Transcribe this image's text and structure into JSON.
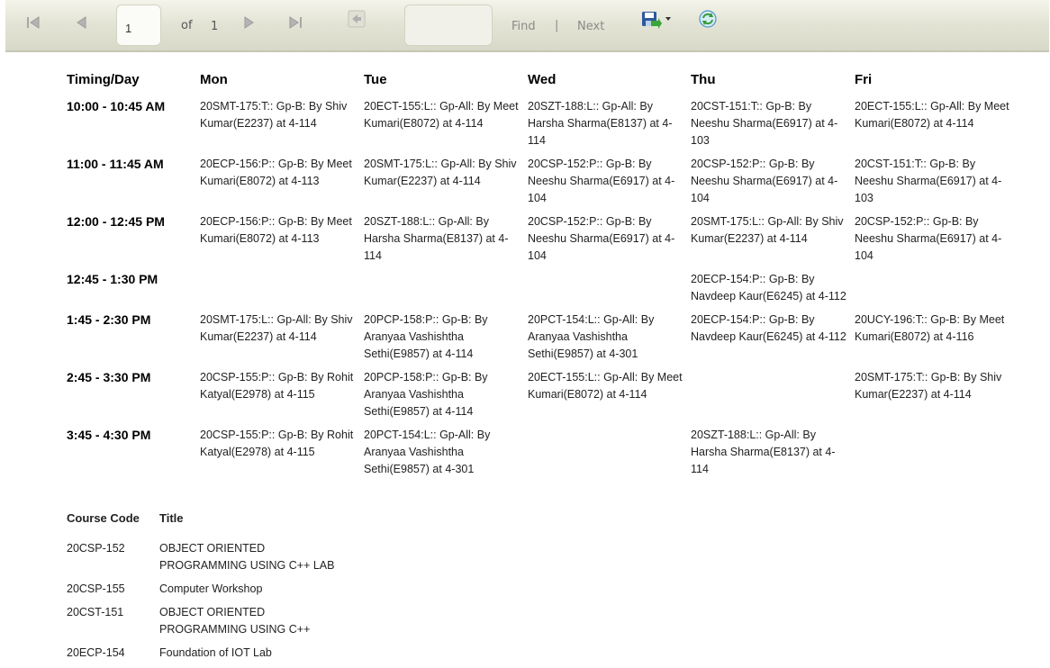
{
  "toolbar": {
    "page_current": "1",
    "of_label": "of",
    "page_total": "1",
    "find_label": "Find",
    "separator": "|",
    "next_label": "Next",
    "icons": [
      "first-page-icon",
      "prev-page-icon",
      "next-page-icon",
      "last-page-icon",
      "back-to-parent-icon",
      "save-export-icon",
      "refresh-icon"
    ]
  },
  "timetable": {
    "header": {
      "timing": "Timing/Day",
      "days": [
        "Mon",
        "Tue",
        "Wed",
        "Thu",
        "Fri"
      ]
    },
    "rows": [
      {
        "time": "10:00 - 10:45 AM",
        "cells": [
          "20SMT-175:T:: Gp-B: By Shiv Kumar(E2237) at 4-114",
          "20ECT-155:L:: Gp-All: By Meet Kumari(E8072) at 4-114",
          "20SZT-188:L:: Gp-All: By Harsha Sharma(E8137) at 4-114",
          "20CST-151:T:: Gp-B: By Neeshu Sharma(E6917) at 4-103",
          "20ECT-155:L:: Gp-All: By Meet Kumari(E8072) at 4-114"
        ]
      },
      {
        "time": "11:00 - 11:45 AM",
        "cells": [
          "20ECP-156:P:: Gp-B: By Meet Kumari(E8072) at 4-113",
          "20SMT-175:L:: Gp-All: By Shiv Kumar(E2237) at 4-114",
          "20CSP-152:P:: Gp-B: By Neeshu Sharma(E6917) at 4-104",
          "20CSP-152:P:: Gp-B: By Neeshu Sharma(E6917) at 4-104",
          "20CST-151:T:: Gp-B: By Neeshu Sharma(E6917) at 4-103"
        ]
      },
      {
        "time": "12:00 - 12:45 PM",
        "cells": [
          "20ECP-156:P:: Gp-B: By Meet Kumari(E8072) at 4-113",
          "20SZT-188:L:: Gp-All: By Harsha Sharma(E8137) at 4-114",
          "20CSP-152:P:: Gp-B: By Neeshu Sharma(E6917) at 4-104",
          "20SMT-175:L:: Gp-All: By Shiv Kumar(E2237) at 4-114",
          "20CSP-152:P:: Gp-B: By Neeshu Sharma(E6917) at 4-104"
        ]
      },
      {
        "time": "12:45 - 1:30 PM",
        "cells": [
          "",
          "",
          "",
          "20ECP-154:P:: Gp-B: By Navdeep Kaur(E6245) at 4-112",
          ""
        ]
      },
      {
        "time": "1:45 - 2:30 PM",
        "cells": [
          "20SMT-175:L:: Gp-All: By Shiv Kumar(E2237) at 4-114",
          "20PCP-158:P:: Gp-B: By Aranyaa Vashishtha Sethi(E9857) at 4-114",
          "20PCT-154:L:: Gp-All: By Aranyaa Vashishtha Sethi(E9857) at 4-301",
          "20ECP-154:P:: Gp-B: By Navdeep Kaur(E6245) at 4-112",
          "20UCY-196:T:: Gp-B: By Meet Kumari(E8072) at 4-116"
        ]
      },
      {
        "time": "2:45 - 3:30 PM",
        "cells": [
          "20CSP-155:P:: Gp-B: By Rohit Katyal(E2978) at 4-115",
          "20PCP-158:P:: Gp-B: By Aranyaa Vashishtha Sethi(E9857) at 4-114",
          "20ECT-155:L:: Gp-All: By Meet Kumari(E8072) at 4-114",
          "",
          "20SMT-175:T:: Gp-B: By Shiv Kumar(E2237) at 4-114"
        ]
      },
      {
        "time": "3:45 - 4:30 PM",
        "cells": [
          "20CSP-155:P:: Gp-B: By Rohit Katyal(E2978) at 4-115",
          "20PCT-154:L:: Gp-All: By Aranyaa Vashishtha Sethi(E9857) at 4-301",
          "",
          "20SZT-188:L:: Gp-All: By Harsha Sharma(E8137) at 4-114",
          ""
        ]
      }
    ]
  },
  "courses": {
    "header": {
      "code": "Course Code",
      "title": "Title"
    },
    "rows": [
      {
        "code": "20CSP-152",
        "title": "OBJECT ORIENTED PROGRAMMING USING C++ LAB"
      },
      {
        "code": "20CSP-155",
        "title": "Computer Workshop"
      },
      {
        "code": "20CST-151",
        "title": "OBJECT ORIENTED PROGRAMMING USING C++"
      },
      {
        "code": "20ECP-154",
        "title": "Foundation of IOT Lab"
      }
    ]
  }
}
